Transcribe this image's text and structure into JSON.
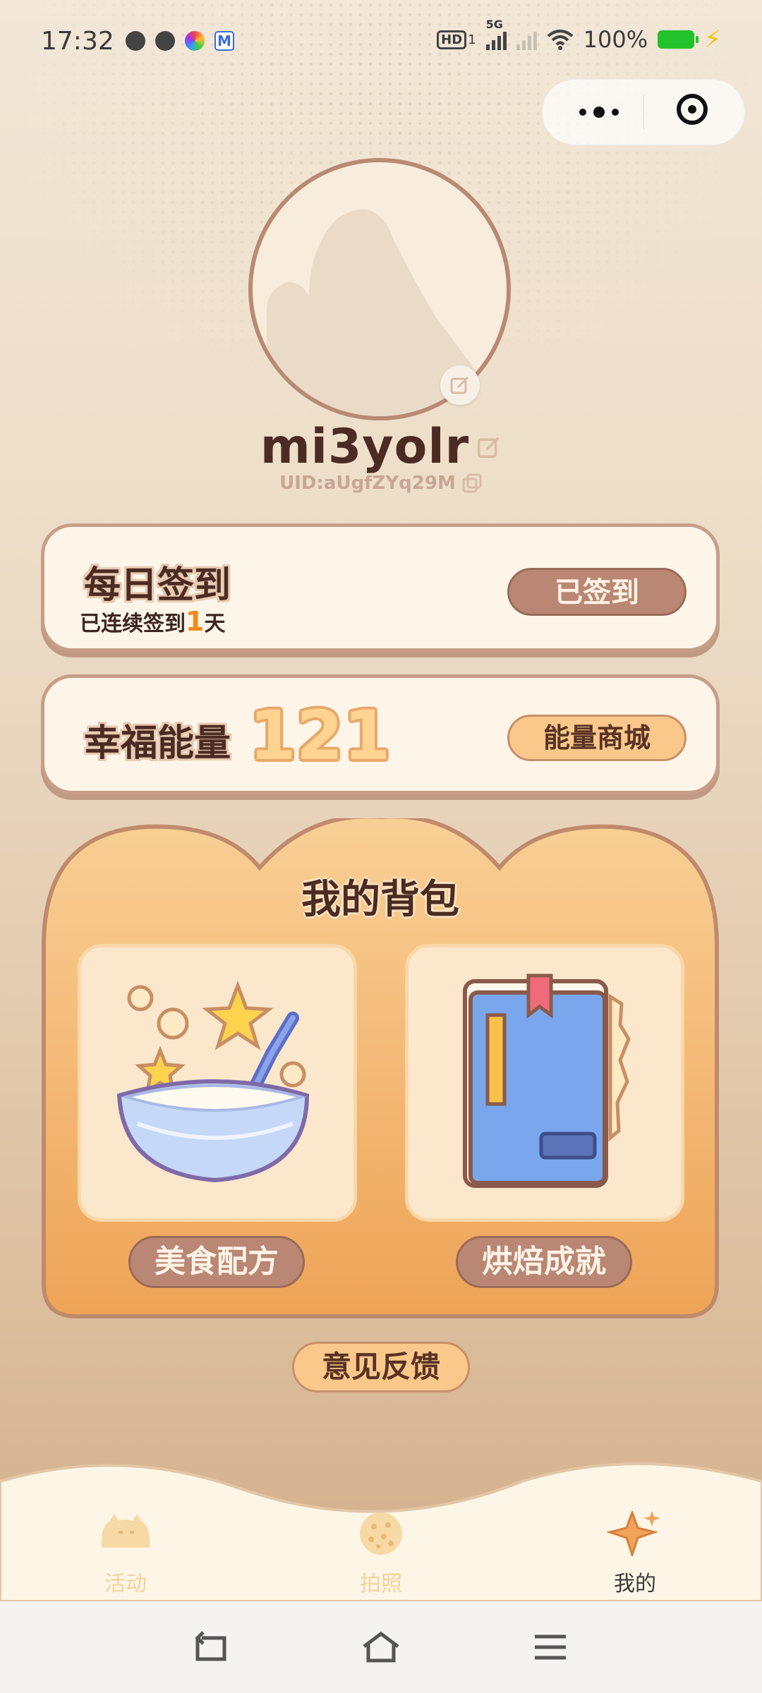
{
  "status_bar": {
    "time": "17:32",
    "battery": "100%",
    "network": "5G",
    "hd_badge": "HD",
    "hd_sub": "1",
    "notification_icons": [
      "globe-icon",
      "stopwatch-icon",
      "nbc-peacock-icon",
      "gmail-icon"
    ]
  },
  "capsule": {
    "more_icon": "more-dots-icon",
    "close_icon": "target-close-icon"
  },
  "profile": {
    "username": "mi3yolr",
    "uid": "UID:aUgfZYq29M"
  },
  "checkin": {
    "title": "每日签到",
    "streak_prefix": "已连续签到",
    "streak_days": "1",
    "streak_suffix": "天",
    "button_label": "已签到"
  },
  "energy": {
    "title": "幸福能量",
    "value": "121",
    "button_label": "能量商城"
  },
  "backpack": {
    "title": "我的背包",
    "items": [
      {
        "label": "美食配方",
        "icon": "mixing-bowl-icon"
      },
      {
        "label": "烘焙成就",
        "icon": "book-icon"
      }
    ]
  },
  "feedback": {
    "label": "意见反馈"
  },
  "tabs": [
    {
      "label": "活动",
      "icon": "cat-bun-icon",
      "active": false
    },
    {
      "label": "拍照",
      "icon": "cookie-icon",
      "active": false
    },
    {
      "label": "我的",
      "icon": "star-cookie-icon",
      "active": true
    }
  ],
  "colors": {
    "accent_orange": "#f08a1c",
    "brown": "#b98774",
    "dark_text": "#4b2b22",
    "inactive_tab": "#f3d29c",
    "battery_green": "#22c22c"
  }
}
